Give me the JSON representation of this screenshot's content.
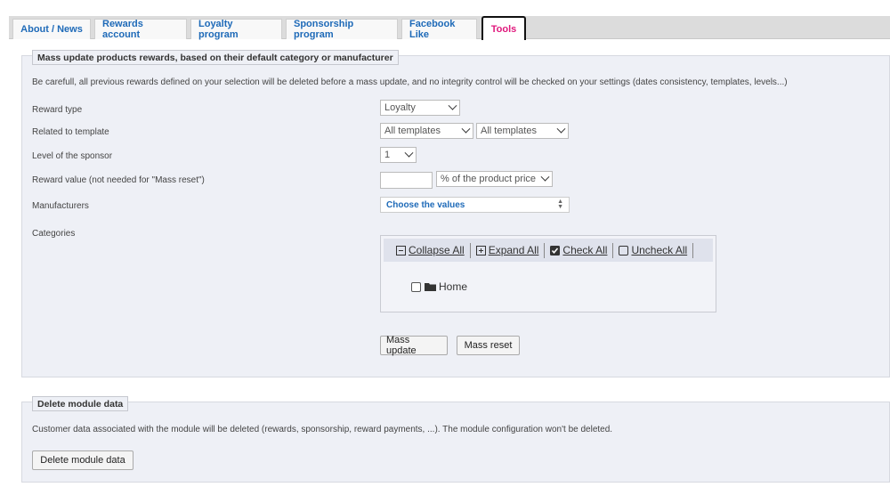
{
  "tabs": [
    {
      "label": "About / News"
    },
    {
      "label": "Rewards account"
    },
    {
      "label": "Loyalty program"
    },
    {
      "label": "Sponsorship program"
    },
    {
      "label": "Facebook Like"
    },
    {
      "label": "Tools"
    }
  ],
  "mass_update": {
    "legend": "Mass update products rewards, based on their default category or manufacturer",
    "warning": "Be carefull, all previous rewards defined on your selection will be deleted before a mass update, and no integrity control will be checked on your settings (dates consistency, templates, levels...)",
    "reward_type_label": "Reward type",
    "reward_type_value": "Loyalty",
    "template_label": "Related to template",
    "template_value_1": "All templates",
    "template_value_2": "All templates",
    "level_label": "Level of the sponsor",
    "level_value": "1",
    "reward_value_label": "Reward value (not needed for \"Mass reset\")",
    "reward_value_input": "",
    "reward_unit_value": "% of the product price",
    "manufacturers_label": "Manufacturers",
    "manufacturers_placeholder": "Choose the values",
    "categories_label": "Categories",
    "tree": {
      "collapse_all": "Collapse All",
      "expand_all": "Expand All",
      "check_all": "Check All",
      "uncheck_all": "Uncheck All",
      "root_node": "Home"
    },
    "mass_update_button": "Mass update",
    "mass_reset_button": "Mass reset"
  },
  "delete_data": {
    "legend": "Delete module data",
    "note": "Customer data associated with the module will be deleted (rewards, sponsorship, reward payments, ...). The module configuration won't be deleted.",
    "button": "Delete module data"
  },
  "colors": {
    "tab_text": "#1e6ab8",
    "active_tab_text": "#e0197d",
    "panel_bg": "#eef0f6"
  }
}
